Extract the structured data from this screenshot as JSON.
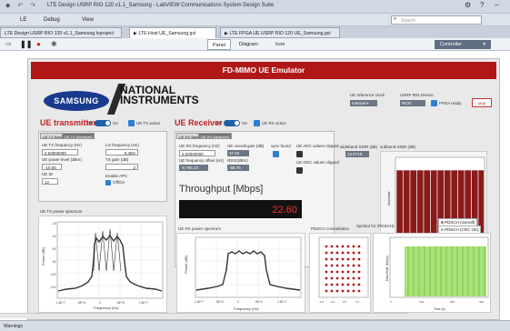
{
  "window": {
    "title": "LTE Design USRP RIO 120 v1.1_Samsung - LabVIEW Communications System Design Suite"
  },
  "menu": {
    "items": [
      "LE",
      "Debug",
      "View"
    ],
    "search_placeholder": "Search"
  },
  "tabs": [
    {
      "label": "LTE Design USRP RIO 120 v1.1_Samsung.lvproject"
    },
    {
      "label": "LTE Host UE_Samsung.gvi"
    },
    {
      "label": "LTE FPGA UE USRP RIO 120 UE_Samsung.gvi"
    }
  ],
  "panel_tabs": [
    "Panel",
    "Diagram",
    "Icon"
  ],
  "controller_label": "Controller",
  "header": {
    "title": "FD-MIMO UE Emulator"
  },
  "logos": {
    "samsung": "SAMSUNG",
    "ni_line1": "NATIONAL",
    "ni_line2": "INSTRUMENTS"
  },
  "settings": {
    "ref_clock_label": "UE reference clock",
    "ref_clock_value": "Internal",
    "device_label": "USRP RIO Device",
    "device_value": "RIO0",
    "fpga_ready": "FPGA ready",
    "stop": "stop"
  },
  "transmitter": {
    "title": "UE transmitter",
    "off": "Off",
    "on": "On",
    "active": "UE TX active",
    "subtabs": [
      "UE TX Basic",
      "UE TX Advanced"
    ],
    "tx_freq_label": "UE TX frequency (Hz)",
    "tx_freq_value": "2.53000000",
    "power_label": "UE power level (dBm)",
    "power_value": "-10.00",
    "ue_id_label": "UE ID",
    "ue_id_value": "12",
    "lo_freq_label": "LO frequency (Hz)",
    "lo_freq_value": "3.46G",
    "tx_gain_label": "TX gain (dB)",
    "tx_gain_value": "2",
    "apc_label": "Enable APC",
    "apc_value": "Off/On",
    "spectrum_title": "UE TX power spectrum"
  },
  "receiver": {
    "title": "UE Receiver",
    "off": "Off",
    "on": "On",
    "active": "UE RX active",
    "subtabs": [
      "UE RX Basic",
      "UE RX Advanced"
    ],
    "rx_freq_label": "UE RX frequency (Hz)",
    "rx_freq_value": "2.53000000",
    "offset_label": "UE frequency offset (Hz)",
    "offset_value": "-8,795.23",
    "gain_label": "UE overall gain (dB)",
    "gain_value": "37.50",
    "rssi_label": "RSSI(dBm)",
    "rssi_value": "-58.75",
    "sync_label": "sync found",
    "adc_label": "UE ADC values clipped",
    "ddc_label": "UE DDC values clipped",
    "spectrum_title": "UE RX power spectrum"
  },
  "throughput": {
    "title": "Throughput [Mbps]",
    "value": "22.60"
  },
  "sinr": {
    "wideband_label": "wideband SINR (dB)",
    "wideband_value": "12.6719",
    "subband_label": "subband SINR (dB)"
  },
  "pdsch": {
    "const_title": "PDSCH constellation",
    "symbol_label": "Symbol for (PDSCH)",
    "legend_overall": "PDSCH (overall)",
    "legend_crc": "PDSCH (CRC OK)"
  },
  "status": {
    "warnings": "Warnings"
  },
  "colors": {
    "accent_red": "#b01818",
    "blue": "#2d7fd0"
  }
}
